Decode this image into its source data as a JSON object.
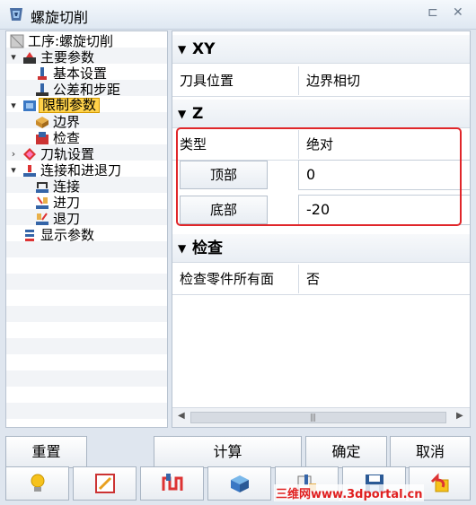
{
  "window": {
    "title": "螺旋切削",
    "pin_icon": "pin-icon",
    "close_icon": "close-icon"
  },
  "tree": {
    "items": [
      {
        "label": "工序:螺旋切削",
        "icon": "operation-icon",
        "expander": ""
      },
      {
        "label": "主要参数",
        "icon": "main-params-icon",
        "expander": "▾"
      },
      {
        "label": "基本设置",
        "icon": "basic-settings-icon",
        "expander": ""
      },
      {
        "label": "公差和步距",
        "icon": "tolerance-icon",
        "expander": ""
      },
      {
        "label": "限制参数",
        "icon": "limit-params-icon",
        "expander": "▾"
      },
      {
        "label": "边界",
        "icon": "boundary-icon",
        "expander": ""
      },
      {
        "label": "检查",
        "icon": "check-icon",
        "expander": ""
      },
      {
        "label": "刀轨设置",
        "icon": "toolpath-icon",
        "expander": "›"
      },
      {
        "label": "连接和进退刀",
        "icon": "link-icon",
        "expander": "▾"
      },
      {
        "label": "连接",
        "icon": "connect-icon",
        "expander": ""
      },
      {
        "label": "进刀",
        "icon": "lead-in-icon",
        "expander": ""
      },
      {
        "label": "退刀",
        "icon": "lead-out-icon",
        "expander": ""
      },
      {
        "label": "显示参数",
        "icon": "display-icon",
        "expander": ""
      }
    ]
  },
  "panel": {
    "xy": {
      "title": "XY",
      "tool_position_label": "刀具位置",
      "tool_position_value": "边界相切"
    },
    "z": {
      "title": "Z",
      "type_label": "类型",
      "type_value": "绝对",
      "top_label": "顶部",
      "top_value": "0",
      "bottom_label": "底部",
      "bottom_value": "-20"
    },
    "check": {
      "title": "检查",
      "all_faces_label": "检查零件所有面",
      "all_faces_value": "否"
    }
  },
  "buttons": {
    "reset": "重置",
    "compute": "计算",
    "ok": "确定",
    "cancel": "取消"
  },
  "toolbar_icons": [
    "lightbulb-icon",
    "edit-icon",
    "toolpath-preview-icon",
    "simulate-icon",
    "parameters-icon",
    "save-icon",
    "undo-icon"
  ],
  "watermark": "三维网www.3dportal.cn",
  "colors": {
    "highlight": "#ffd24a",
    "annotation_red": "#e0262a"
  }
}
